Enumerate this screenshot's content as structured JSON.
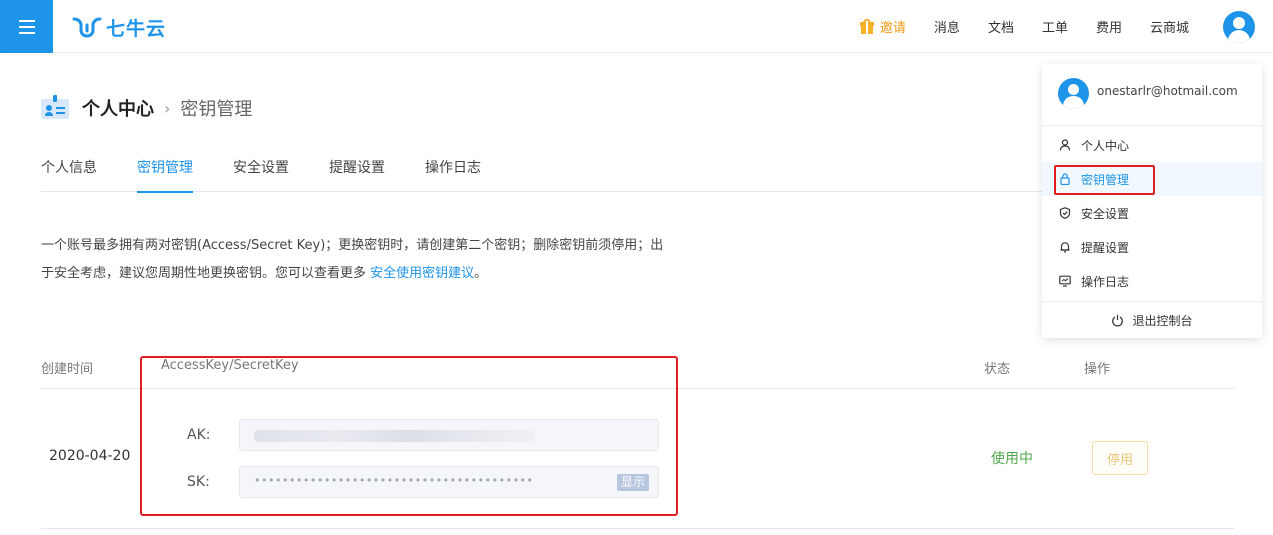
{
  "brand": {
    "logo_text": "七牛云"
  },
  "topnav": {
    "invite": "邀请",
    "items": [
      "消息",
      "文档",
      "工单",
      "费用",
      "云商城"
    ]
  },
  "breadcrumb": {
    "main": "个人中心",
    "separator": "›",
    "sub": "密钥管理"
  },
  "tabs": [
    {
      "label": "个人信息"
    },
    {
      "label": "密钥管理",
      "active": true
    },
    {
      "label": "安全设置"
    },
    {
      "label": "提醒设置"
    },
    {
      "label": "操作日志"
    }
  ],
  "description": {
    "text": "一个账号最多拥有两对密钥(Access/Secret Key)；更换密钥时，请创建第二个密钥；删除密钥前须停用；出于安全考虑，建议您周期性地更换密钥。您可以查看更多 ",
    "link": "安全使用密钥建议",
    "end": "。"
  },
  "table": {
    "headers": {
      "created": "创建时间",
      "keys": "AccessKey/SecretKey",
      "status": "状态",
      "actions": "操作"
    },
    "rows": [
      {
        "created": "2020-04-20",
        "ak_label": "AK:",
        "sk_label": "SK:",
        "sk_masked": "••••••••••••••••••••••••••••••••••••••••",
        "show_label": "显示",
        "status": "使用中",
        "action": "停用"
      }
    ]
  },
  "dropdown": {
    "email": "onestarlr@hotmail.com",
    "items": [
      {
        "label": "个人中心",
        "icon": "user-icon"
      },
      {
        "label": "密钥管理",
        "icon": "lock-icon",
        "active": true
      },
      {
        "label": "安全设置",
        "icon": "shield-icon"
      },
      {
        "label": "提醒设置",
        "icon": "bell-icon"
      },
      {
        "label": "操作日志",
        "icon": "monitor-icon"
      }
    ],
    "logout": "退出控制台"
  },
  "colors": {
    "brand": "#1e94e8",
    "invite": "#f29b18",
    "status_active": "#52a84d",
    "highlight": "#e02020"
  }
}
